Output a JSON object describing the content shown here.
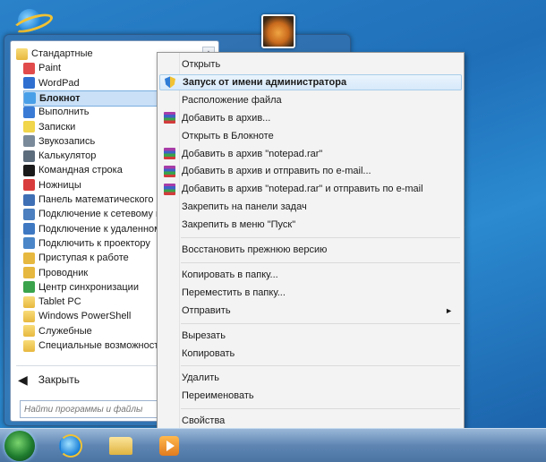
{
  "start_menu": {
    "programs": [
      {
        "label": "Стандартные",
        "icon": "folder-icon",
        "color": "#e7b83f"
      },
      {
        "label": "Paint",
        "icon": "paint-icon",
        "color": "#e24b4b"
      },
      {
        "label": "WordPad",
        "icon": "wordpad-icon",
        "color": "#2f6fd0"
      },
      {
        "label": "Блокнот",
        "icon": "notepad-icon",
        "color": "#4aa0e8",
        "selected": true
      },
      {
        "label": "Выполнить",
        "icon": "run-icon",
        "color": "#3a7bd5"
      },
      {
        "label": "Записки",
        "icon": "sticky-notes-icon",
        "color": "#f1d54a"
      },
      {
        "label": "Звукозапись",
        "icon": "microphone-icon",
        "color": "#7a8a9a"
      },
      {
        "label": "Калькулятор",
        "icon": "calculator-icon",
        "color": "#5c6c7c"
      },
      {
        "label": "Командная строка",
        "icon": "cmd-icon",
        "color": "#1a1a1a"
      },
      {
        "label": "Ножницы",
        "icon": "scissors-icon",
        "color": "#d93c3c"
      },
      {
        "label": "Панель математического ввода",
        "icon": "math-input-icon",
        "color": "#3f6fb5"
      },
      {
        "label": "Подключение к сетевому проектору",
        "icon": "network-projector-icon",
        "color": "#4b7fbf"
      },
      {
        "label": "Подключение к удаленному рабочему столу",
        "icon": "remote-desktop-icon",
        "color": "#3e78c2"
      },
      {
        "label": "Подключить к проектору",
        "icon": "projector-icon",
        "color": "#4a86c8"
      },
      {
        "label": "Приступая к работе",
        "icon": "getting-started-icon",
        "color": "#e7b83f"
      },
      {
        "label": "Проводник",
        "icon": "explorer-icon",
        "color": "#e7b83f"
      },
      {
        "label": "Центр синхронизации",
        "icon": "sync-center-icon",
        "color": "#3aa34b"
      },
      {
        "label": "Tablet PC",
        "icon": "folder-icon",
        "color": "#e7b83f"
      },
      {
        "label": "Windows PowerShell",
        "icon": "folder-icon",
        "color": "#e7b83f"
      },
      {
        "label": "Служебные",
        "icon": "folder-icon",
        "color": "#e7b83f"
      },
      {
        "label": "Специальные возможности",
        "icon": "folder-icon",
        "color": "#e7b83f"
      }
    ],
    "back_label": "Закрыть",
    "search_placeholder": "Найти программы и файлы"
  },
  "context_menu": {
    "groups": [
      [
        {
          "label": "Открыть",
          "icon": ""
        },
        {
          "label": "Запуск от имени администратора",
          "icon": "uac-shield-icon",
          "highlighted": true
        },
        {
          "label": "Расположение файла",
          "icon": ""
        },
        {
          "label": "Добавить в архив...",
          "icon": "winrar-icon"
        },
        {
          "label": "Открыть в Блокноте",
          "icon": ""
        },
        {
          "label": "Добавить в архив \"notepad.rar\"",
          "icon": "winrar-icon"
        },
        {
          "label": "Добавить в архив и отправить по e-mail...",
          "icon": "winrar-icon"
        },
        {
          "label": "Добавить в архив \"notepad.rar\" и отправить по e-mail",
          "icon": "winrar-icon"
        },
        {
          "label": "Закрепить на панели задач",
          "icon": ""
        },
        {
          "label": "Закрепить в меню \"Пуск\"",
          "icon": ""
        }
      ],
      [
        {
          "label": "Восстановить прежнюю версию",
          "icon": ""
        }
      ],
      [
        {
          "label": "Копировать в папку...",
          "icon": ""
        },
        {
          "label": "Переместить в папку...",
          "icon": ""
        },
        {
          "label": "Отправить",
          "icon": "",
          "submenu": true
        }
      ],
      [
        {
          "label": "Вырезать",
          "icon": ""
        },
        {
          "label": "Копировать",
          "icon": ""
        }
      ],
      [
        {
          "label": "Удалить",
          "icon": ""
        },
        {
          "label": "Переименовать",
          "icon": ""
        }
      ],
      [
        {
          "label": "Свойства",
          "icon": ""
        }
      ]
    ]
  },
  "taskbar": {
    "items": [
      "start-orb-icon",
      "internet-explorer-icon",
      "windows-explorer-icon",
      "media-player-icon"
    ]
  }
}
